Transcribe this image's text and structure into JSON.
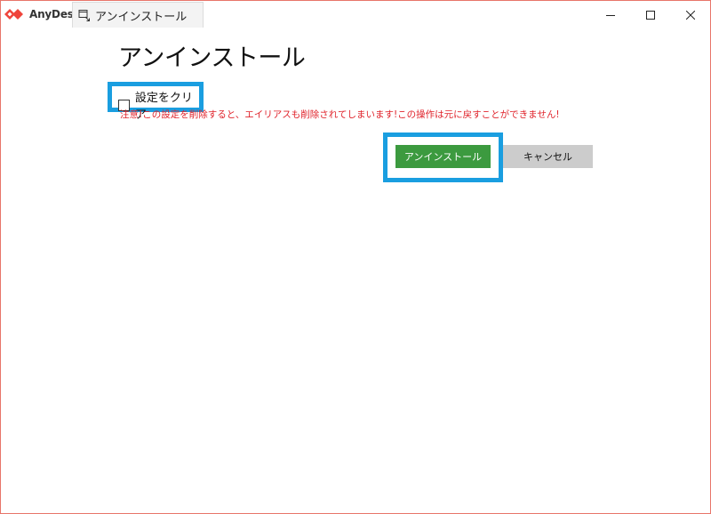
{
  "app": {
    "name": "AnyDesk"
  },
  "tab": {
    "label": "アンインストール",
    "icon": "uninstall-icon"
  },
  "window_controls": {
    "minimize_icon": "minimize-icon",
    "maximize_icon": "maximize-icon",
    "close_icon": "close-icon"
  },
  "page": {
    "title": "アンインストール",
    "clear_settings_label": "設定をクリア",
    "clear_settings_checked": false,
    "warning": "注意!この設定を削除すると、エイリアスも削除されてしまいます!この操作は元に戻すことができません!",
    "uninstall_button": "アンインストール",
    "cancel_button": "キャンセル"
  },
  "colors": {
    "brand": "#ef443b",
    "highlight": "#1a9ee0",
    "uninstall_button_bg": "#3c9a3f",
    "cancel_button_bg": "#cccccc",
    "warning_text": "#e0242c",
    "window_border": "#e8756a"
  }
}
